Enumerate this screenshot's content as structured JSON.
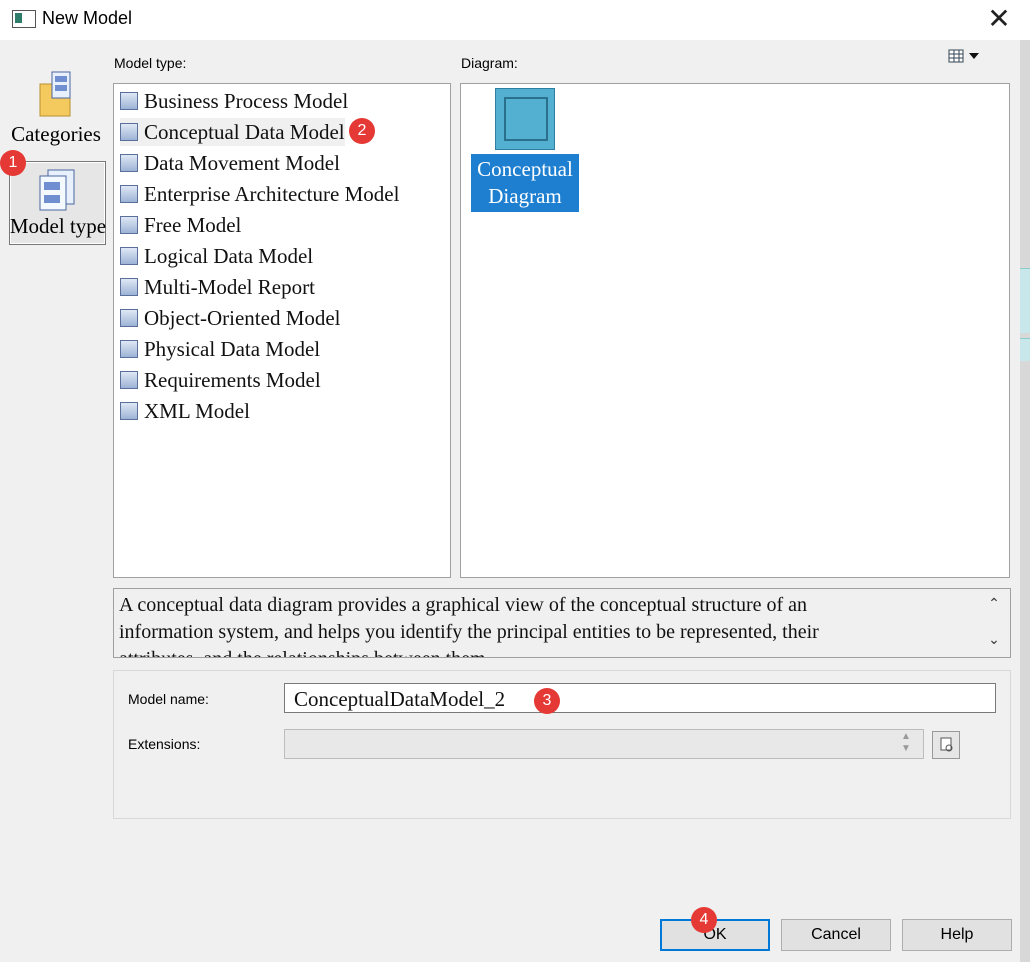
{
  "window": {
    "title": "New Model",
    "close_icon": "close-icon"
  },
  "left_pane": {
    "items": [
      {
        "label": "Categories",
        "icon": "categories-icon"
      },
      {
        "label": "Model type",
        "icon": "model-type-icon",
        "selected": true
      }
    ]
  },
  "model_type": {
    "label": "Model type:",
    "items": [
      {
        "label": "Business Process Model",
        "icon": "business-process-icon"
      },
      {
        "label": "Conceptual Data Model",
        "icon": "conceptual-data-icon",
        "selected": true
      },
      {
        "label": "Data Movement Model",
        "icon": "data-movement-icon"
      },
      {
        "label": "Enterprise Architecture Model",
        "icon": "enterprise-architecture-icon"
      },
      {
        "label": "Free Model",
        "icon": "free-model-icon"
      },
      {
        "label": "Logical Data Model",
        "icon": "logical-data-icon"
      },
      {
        "label": "Multi-Model Report",
        "icon": "multi-model-report-icon"
      },
      {
        "label": "Object-Oriented Model",
        "icon": "object-oriented-icon"
      },
      {
        "label": "Physical Data Model",
        "icon": "physical-data-icon"
      },
      {
        "label": "Requirements Model",
        "icon": "requirements-icon"
      },
      {
        "label": "XML Model",
        "icon": "xml-model-icon"
      }
    ]
  },
  "diagram": {
    "label": "Diagram:",
    "view_toggle_icon": "view-list-icon",
    "items": [
      {
        "label_line1": "Conceptual",
        "label_line2": "Diagram",
        "icon": "conceptual-diagram-icon",
        "selected": true
      }
    ]
  },
  "description": {
    "line1": "A conceptual data diagram provides a graphical view of the conceptual structure of an",
    "line2": "information system, and helps you identify the principal entities to be represented, their",
    "line3": "attributes, and the relationships between them."
  },
  "form": {
    "model_name_label": "Model name:",
    "model_name_value": "ConceptualDataModel_2",
    "extensions_label": "Extensions:",
    "extensions_value": ""
  },
  "buttons": {
    "ok": "OK",
    "cancel": "Cancel",
    "help": "Help"
  },
  "badges": [
    "1",
    "2",
    "3",
    "4"
  ],
  "colors": {
    "selection": "#1e7fd0",
    "badge": "#e53935"
  }
}
